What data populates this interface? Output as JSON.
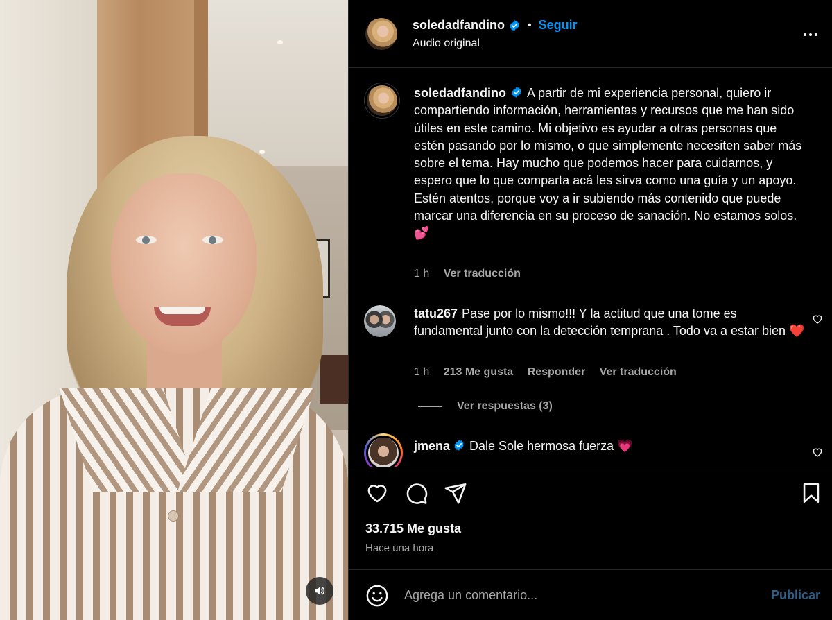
{
  "header": {
    "username": "soledadfandino",
    "follow_label": "Seguir",
    "separator": "•",
    "audio_label": "Audio original"
  },
  "caption": {
    "username": "soledadfandino",
    "text": "A partir de mi experiencia personal, quiero ir compartiendo información, herramientas y recursos que me han sido útiles en este camino. Mi objetivo es ayudar a otras personas que estén pasando por lo mismo, o que simplemente necesiten saber más sobre el tema. Hay mucho que podemos hacer para cuidarnos, y espero que lo que comparta acá les sirva como una guía y un apoyo. Estén atentos, porque voy a ir subiendo más contenido que puede marcar una diferencia en su proceso de sanación. No estamos solos. 💕",
    "time": "1 h",
    "translate_label": "Ver traducción"
  },
  "comments": [
    {
      "username": "tatu267",
      "text": "Pase por lo mismo!!! Y la actitud que una tome es fundamental junto con la detección temprana . Todo va a estar bien ❤️",
      "time": "1 h",
      "likes": "213 Me gusta",
      "reply_label": "Responder",
      "translate_label": "Ver traducción",
      "view_replies": "Ver respuestas (3)"
    },
    {
      "username": "jmena",
      "text": "Dale Sole hermosa fuerza 💗"
    }
  ],
  "actions": {
    "likes_count": "33.715 Me gusta",
    "posted_time": "Hace una hora"
  },
  "composer": {
    "placeholder": "Agrega un comentario...",
    "publish_label": "Publicar"
  },
  "colors": {
    "accent": "#0095f6",
    "background": "#000000",
    "muted_text": "#a8a8a8",
    "publish_disabled": "#2f5f86"
  },
  "icons": [
    "speaker-icon",
    "verified-badge-icon",
    "more-options-icon",
    "heart-icon",
    "comment-icon",
    "share-icon",
    "bookmark-icon",
    "emoji-icon"
  ]
}
